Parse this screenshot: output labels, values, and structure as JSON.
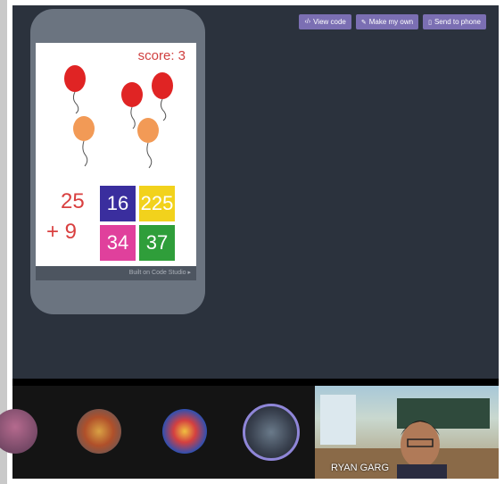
{
  "toolbar": {
    "view_code": "View code",
    "make_my_own": "Make my own",
    "send_to_phone": "Send to phone"
  },
  "app": {
    "score": "score: 3",
    "equation": {
      "first": "25",
      "second": "+ 9"
    },
    "answers": [
      {
        "label": "16",
        "color": "#3a2e9e"
      },
      {
        "label": "225",
        "color": "#f2d21c"
      },
      {
        "label": "34",
        "color": "#e0409c"
      },
      {
        "label": "37",
        "color": "#2f9e3a"
      }
    ],
    "footer": "Built on Code Studio ▸"
  },
  "call": {
    "participant_name": "RYAN GARG"
  },
  "colors": {
    "balloon_red": "#e02424",
    "balloon_orange": "#f29a56",
    "accent": "#7b6fb3"
  }
}
